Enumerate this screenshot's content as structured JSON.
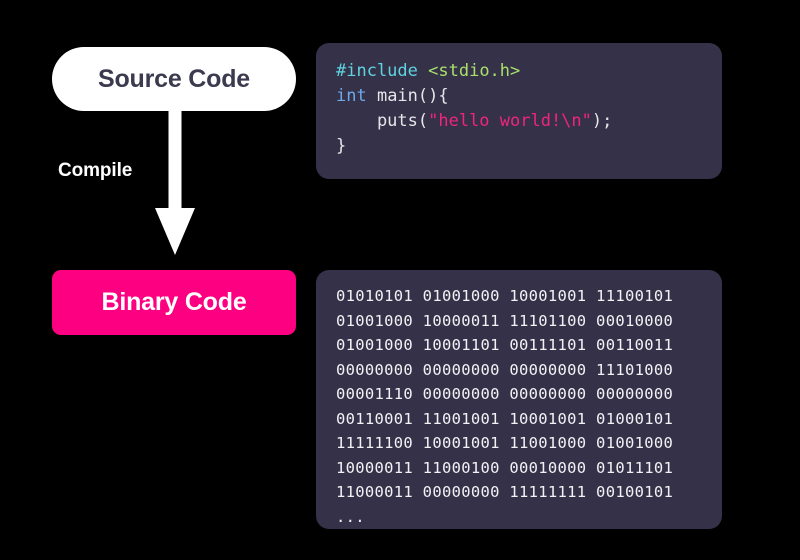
{
  "diagram": {
    "title": "Compilation flow: Source Code to Binary Code",
    "background_color": "#000000",
    "panel_color": "#353149",
    "accent_pink": "#FD0081",
    "pill_white": "#FFFFFF"
  },
  "nodes": {
    "source": {
      "label": "Source Code",
      "shape": "rounded-pill",
      "fill": "#FFFFFF",
      "text_color": "#3B3A4E"
    },
    "binary": {
      "label": "Binary Code",
      "shape": "rounded-rect",
      "fill": "#FD0081",
      "text_color": "#FFFFFF"
    }
  },
  "edge": {
    "label": "Compile",
    "direction": "down",
    "color": "#FFFFFF"
  },
  "source_code_panel": {
    "language": "c",
    "lines": [
      {
        "tokens": [
          {
            "text": "#include",
            "type": "preprocessor",
            "color": "#5FD3E0"
          },
          {
            "text": " ",
            "type": "plain",
            "color": "#E6E6EA"
          },
          {
            "text": "<stdio.h>",
            "type": "header",
            "color": "#A8E06A"
          }
        ]
      },
      {
        "tokens": [
          {
            "text": "int",
            "type": "keyword",
            "color": "#6EA8E8"
          },
          {
            "text": " main(){",
            "type": "plain",
            "color": "#E6E6EA"
          }
        ]
      },
      {
        "tokens": [
          {
            "text": "    puts(",
            "type": "plain",
            "color": "#E6E6EA"
          },
          {
            "text": "\"hello world!\\n\"",
            "type": "string",
            "color": "#F0247F"
          },
          {
            "text": ");",
            "type": "plain",
            "color": "#E6E6EA"
          }
        ]
      },
      {
        "tokens": [
          {
            "text": "}",
            "type": "plain",
            "color": "#E6E6EA"
          }
        ]
      }
    ]
  },
  "binary_code_panel": {
    "text_color": "#F2F2F5",
    "lines": [
      "01010101 01001000 10001001 11100101",
      "01001000 10000011 11101100 00010000",
      "01001000 10001101 00111101 00110011",
      "00000000 00000000 00000000 11101000",
      "00001110 00000000 00000000 00000000",
      "00110001 11001001 10001001 01000101",
      "11111100 10001001 11001000 01001000",
      "10000011 11000100 00010000 01011101",
      "11000011 00000000 11111111 00100101",
      "..."
    ]
  }
}
